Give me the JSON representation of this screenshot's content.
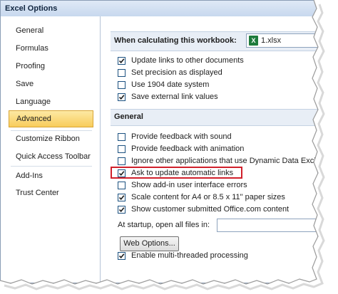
{
  "window": {
    "title": "Excel Options"
  },
  "sidebar": {
    "items": [
      {
        "label": "General"
      },
      {
        "label": "Formulas"
      },
      {
        "label": "Proofing"
      },
      {
        "label": "Save"
      },
      {
        "label": "Language"
      },
      {
        "label": "Advanced",
        "selected": true
      },
      {
        "label": "Customize Ribbon"
      },
      {
        "label": "Quick Access Toolbar"
      },
      {
        "label": "Add-Ins"
      },
      {
        "label": "Trust Center"
      }
    ]
  },
  "calc": {
    "label": "When calculating this workbook:",
    "workbook": "1.xlsx",
    "workbook_icon": "excel-file-icon",
    "options": [
      {
        "label": "Update links to other documents",
        "checked": true
      },
      {
        "label": "Set precision as displayed",
        "checked": false
      },
      {
        "label": "Use 1904 date system",
        "checked": false
      },
      {
        "label": "Save external link values",
        "checked": true
      }
    ]
  },
  "general": {
    "title": "General",
    "options": [
      {
        "label": "Provide feedback with sound",
        "checked": false
      },
      {
        "label": "Provide feedback with animation",
        "checked": false
      },
      {
        "label": "Ignore other applications that use Dynamic Data Exchange (DDE)",
        "checked": false
      },
      {
        "label": "Ask to update automatic links",
        "checked": true,
        "highlighted": true
      },
      {
        "label": "Show add-in user interface errors",
        "checked": false
      },
      {
        "label": "Scale content for A4 or 8.5 x 11\" paper sizes",
        "checked": true
      },
      {
        "label": "Show customer submitted Office.com content",
        "checked": true
      }
    ],
    "startup_label": "At startup, open all files in:",
    "startup_value": "",
    "web_options_button": "Web Options...",
    "multithread": {
      "label": "Enable multi-threaded processing",
      "checked": true
    }
  },
  "colors": {
    "highlight_border": "#d0202b",
    "selected_nav": "#f8cc5b",
    "section_band": "#e8eef6"
  }
}
